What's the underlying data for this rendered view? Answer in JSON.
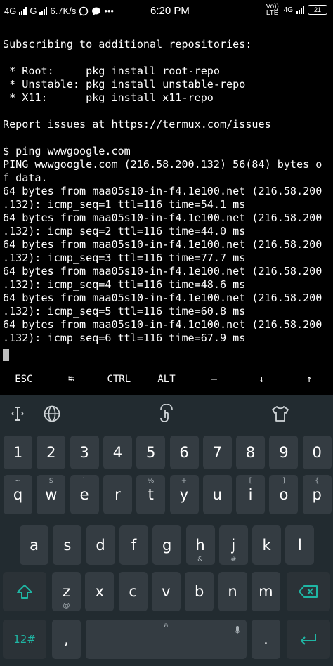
{
  "status_bar": {
    "network_1": "4G",
    "network_2": "G",
    "speed": "6.7K/s",
    "time": "6:20 PM",
    "volte": "Vo)) LTE",
    "network_3": "4G",
    "battery": "21"
  },
  "terminal": {
    "lines": [
      "Subscribing to additional repositories:",
      "",
      " * Root:     pkg install root-repo",
      " * Unstable: pkg install unstable-repo",
      " * X11:      pkg install x11-repo",
      "",
      "Report issues at https://termux.com/issues",
      "",
      "$ ping wwwgoogle.com",
      "PING wwwgoogle.com (216.58.200.132) 56(84) bytes o",
      "f data.",
      "64 bytes from maa05s10-in-f4.1e100.net (216.58.200",
      ".132): icmp_seq=1 ttl=116 time=54.1 ms",
      "64 bytes from maa05s10-in-f4.1e100.net (216.58.200",
      ".132): icmp_seq=2 ttl=116 time=44.0 ms",
      "64 bytes from maa05s10-in-f4.1e100.net (216.58.200",
      ".132): icmp_seq=3 ttl=116 time=77.7 ms",
      "64 bytes from maa05s10-in-f4.1e100.net (216.58.200",
      ".132): icmp_seq=4 ttl=116 time=48.6 ms",
      "64 bytes from maa05s10-in-f4.1e100.net (216.58.200",
      ".132): icmp_seq=5 ttl=116 time=60.8 ms",
      "64 bytes from maa05s10-in-f4.1e100.net (216.58.200",
      ".132): icmp_seq=6 ttl=116 time=67.9 ms"
    ]
  },
  "extra_keys": {
    "esc": "ESC",
    "tab": "⭾",
    "ctrl": "CTRL",
    "alt": "ALT",
    "dash": "—",
    "down": "↓",
    "up": "↑"
  },
  "keyboard": {
    "toolbar_icons": [
      "text-cursor-icon",
      "globe-icon",
      "touch-gesture-icon",
      "shirt-theme-icon"
    ],
    "number_row": [
      "1",
      "2",
      "3",
      "4",
      "5",
      "6",
      "7",
      "8",
      "9",
      "0"
    ],
    "row1": {
      "keys": [
        "q",
        "w",
        "e",
        "r",
        "t",
        "y",
        "u",
        "i",
        "o",
        "p"
      ],
      "subs": [
        "~",
        "$",
        "`",
        "",
        "%",
        "+",
        "",
        "[",
        "]",
        "{"
      ]
    },
    "row2": {
      "keys": [
        "a",
        "s",
        "d",
        "f",
        "g",
        "h",
        "j",
        "k",
        "l"
      ],
      "subs_bottom": [
        "",
        "",
        "",
        "",
        "",
        "&",
        "#",
        "",
        ""
      ],
      "subs_top": [
        "",
        "",
        "",
        "",
        "",
        "",
        "",
        "",
        ""
      ]
    },
    "row3": {
      "keys": [
        "z",
        "x",
        "c",
        "v",
        "b",
        "n",
        "m"
      ],
      "subs_bottom": [
        "@",
        "",
        "",
        "",
        "",
        "",
        ""
      ]
    },
    "sym_label": "12#",
    "comma": ",",
    "space_sub": "a",
    "period": "."
  },
  "colors": {
    "terminal_bg": "#000000",
    "keyboard_bg": "#222b30",
    "key_bg": "#343c42",
    "accent": "#1fb6a4"
  }
}
